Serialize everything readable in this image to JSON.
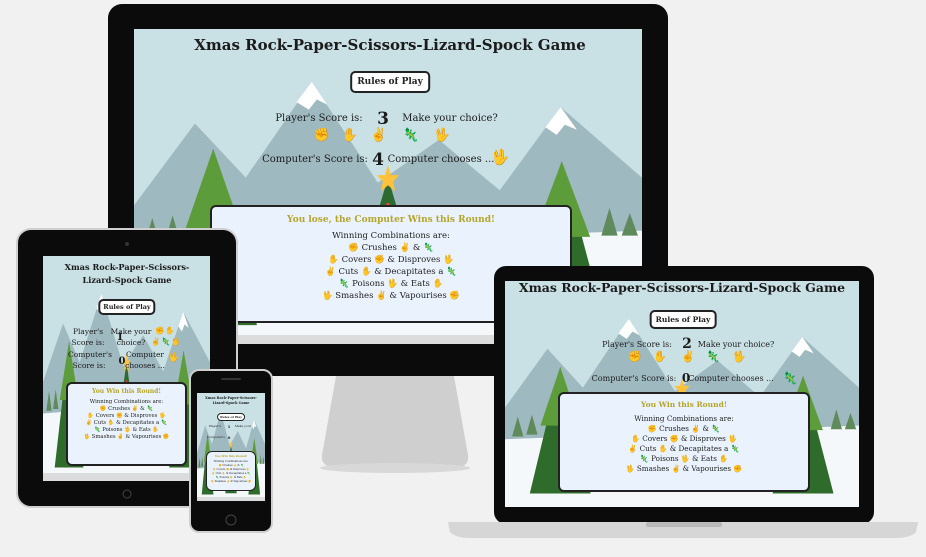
{
  "app": {
    "title": "Xmas Rock-Paper-Scissors-Lizard-Spock Game",
    "title_line1": "Xmas Rock-Paper-Scissors-",
    "title_line2": "Lizard-Spock Game",
    "rules_button": "Rules of Play",
    "player_score_label": "Player's Score is:",
    "computer_score_label": "Computer's Score is:",
    "make_choice_label": "Make your choice?",
    "computer_chooses_label": "Computer chooses ...",
    "player_word": "Player's",
    "score_is_word": "Score is:",
    "computer_word": "Computer's",
    "make_your_word": "Make your",
    "choice_word": "choice?",
    "computer_short": "Computer",
    "chooses_short": "chooses ...",
    "choice_icons": [
      "✊",
      "✋",
      "✌",
      "🦎",
      "🖖"
    ],
    "win_title": "You Win this Round!",
    "lose_title": "You lose, the Computer Wins this Round!",
    "combos_heading": "Winning Combinations are:",
    "combos": [
      "✊ Crushes ✌ & 🦎",
      "✋ Covers ✊ & Disproves 🖖",
      "✌ Cuts ✋ & Decapitates a 🦎",
      "🦎 Poisons 🖖 & Eats ✋",
      "🖖 Smashes ✌ & Vapourises ✊"
    ]
  },
  "desktop": {
    "player_score": "3",
    "computer_score": "4",
    "computer_choice_icon": "🖖"
  },
  "laptop": {
    "player_score": "2",
    "computer_score": "0",
    "computer_choice_icon": "🦎"
  },
  "tablet": {
    "player_score": "1",
    "computer_score": "0",
    "computer_choice_icon": "🖖"
  },
  "phone": {
    "player_score": "1",
    "computer_score": "0"
  },
  "colors": {
    "title_gold": "#b5a52a",
    "panel_bg": "#eaf3fd",
    "sky": "#c9e0e4",
    "tree": "#2f6b2a"
  }
}
